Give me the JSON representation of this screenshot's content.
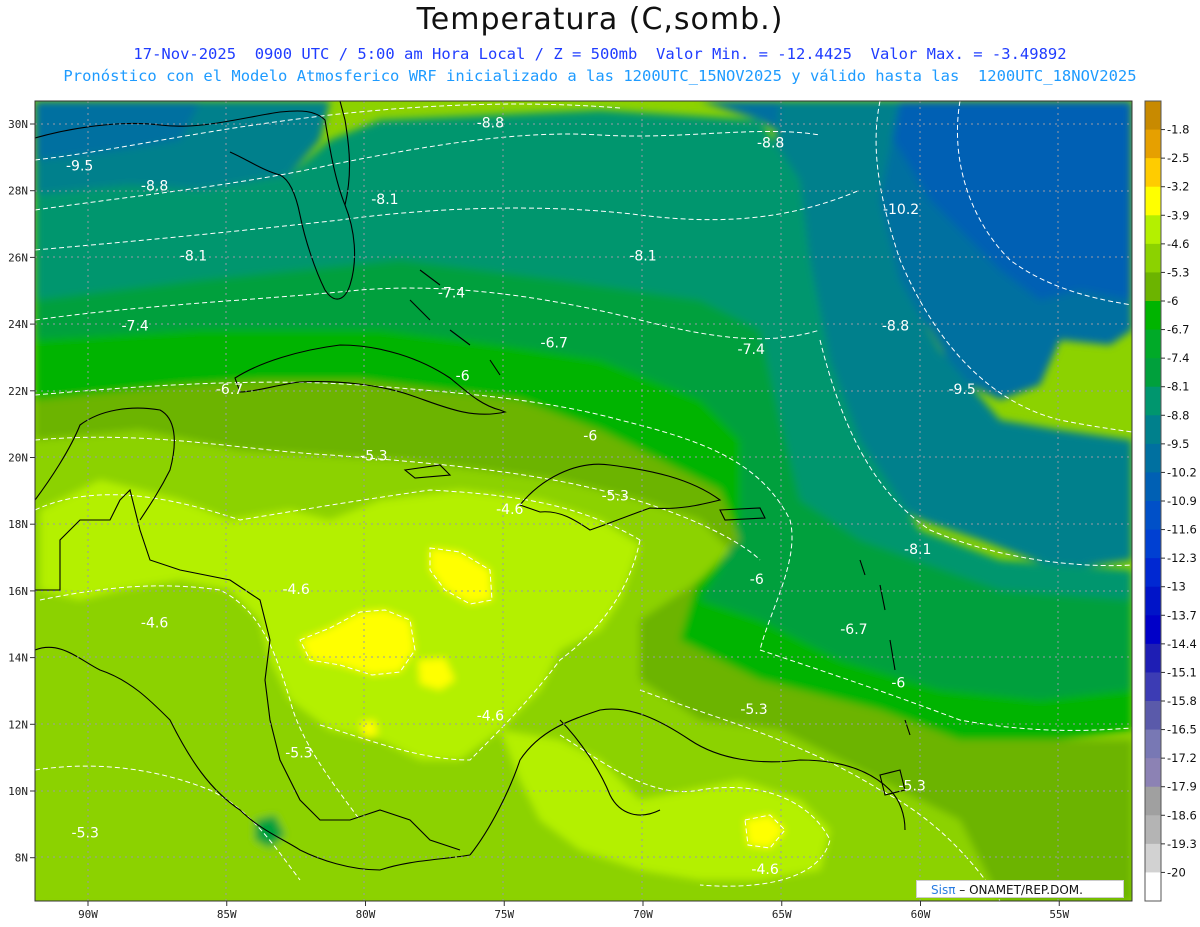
{
  "title": "Temperatura (C,somb.)",
  "subtitle_line1": "17-Nov-2025  0900 UTC / 5:00 am Hora Local / Z = 500mb  Valor Min. = -12.4425  Valor Max. = -3.49892",
  "subtitle_line2": "Pronóstico con el Modelo Atmosferico WRF inicializado a las 1200UTC_15NOV2025 y válido hasta las  1200UTC_18NOV2025",
  "map": {
    "lon_ticks": [
      "90W",
      "85W",
      "80W",
      "75W",
      "70W",
      "65W",
      "60W",
      "55W"
    ],
    "lat_ticks": [
      "30N",
      "28N",
      "26N",
      "24N",
      "22N",
      "20N",
      "18N",
      "16N",
      "14N",
      "12N",
      "10N",
      "8N"
    ],
    "contour_labels": [
      {
        "text": "-8.8",
        "lon": -75.5,
        "lat": 29.9
      },
      {
        "text": "-8.8",
        "lon": -65.4,
        "lat": 29.3
      },
      {
        "text": "-9.5",
        "lon": -90.3,
        "lat": 28.6
      },
      {
        "text": "-8.8",
        "lon": -87.6,
        "lat": 28.0
      },
      {
        "text": "-8.1",
        "lon": -79.3,
        "lat": 27.6
      },
      {
        "text": "-10.2",
        "lon": -60.7,
        "lat": 27.3
      },
      {
        "text": "-8.1",
        "lon": -86.2,
        "lat": 25.9
      },
      {
        "text": "-8.1",
        "lon": -70.0,
        "lat": 25.9
      },
      {
        "text": "-7.4",
        "lon": -76.9,
        "lat": 24.8
      },
      {
        "text": "-7.4",
        "lon": -88.3,
        "lat": 23.8
      },
      {
        "text": "-8.8",
        "lon": -60.9,
        "lat": 23.8
      },
      {
        "text": "-6.7",
        "lon": -73.2,
        "lat": 23.3
      },
      {
        "text": "-7.4",
        "lon": -66.1,
        "lat": 23.1
      },
      {
        "text": "-6",
        "lon": -76.5,
        "lat": 22.3
      },
      {
        "text": "-6.7",
        "lon": -84.9,
        "lat": 21.9
      },
      {
        "text": "-9.5",
        "lon": -58.5,
        "lat": 21.9
      },
      {
        "text": "-6",
        "lon": -71.9,
        "lat": 20.5
      },
      {
        "text": "-5.3",
        "lon": -79.7,
        "lat": 19.9
      },
      {
        "text": "-5.3",
        "lon": -71.0,
        "lat": 18.7
      },
      {
        "text": "-4.6",
        "lon": -74.8,
        "lat": 18.3
      },
      {
        "text": "-8.1",
        "lon": -60.1,
        "lat": 17.1
      },
      {
        "text": "-6",
        "lon": -65.9,
        "lat": 16.2
      },
      {
        "text": "-4.6",
        "lon": -82.5,
        "lat": 15.9
      },
      {
        "text": "-4.6",
        "lon": -87.6,
        "lat": 14.9
      },
      {
        "text": "-6.7",
        "lon": -62.4,
        "lat": 14.7
      },
      {
        "text": "-6",
        "lon": -60.8,
        "lat": 13.1
      },
      {
        "text": "-5.3",
        "lon": -66.0,
        "lat": 12.3
      },
      {
        "text": "-4.6",
        "lon": -75.5,
        "lat": 12.1
      },
      {
        "text": "-5.3",
        "lon": -82.4,
        "lat": 11.0
      },
      {
        "text": "-5.3",
        "lon": -60.3,
        "lat": 10.0
      },
      {
        "text": "-5.3",
        "lon": -90.1,
        "lat": 8.6
      },
      {
        "text": "-4.6",
        "lon": -65.6,
        "lat": 7.5
      }
    ]
  },
  "colorbar": {
    "levels": [
      "-1.8",
      "-2.5",
      "-3.2",
      "-3.9",
      "-4.6",
      "-5.3",
      "-6",
      "-6.7",
      "-7.4",
      "-8.1",
      "-8.8",
      "-9.5",
      "-10.2",
      "-10.9",
      "-11.6",
      "-12.3",
      "-13",
      "-13.7",
      "-14.4",
      "-15.1",
      "-15.8",
      "-16.5",
      "-17.2",
      "-17.9",
      "-18.6",
      "-19.3",
      "-20"
    ],
    "colors": [
      "#c88a00",
      "#e6a000",
      "#ffcc00",
      "#ffff00",
      "#b4f000",
      "#8cd200",
      "#6cb400",
      "#00b400",
      "#00aa28",
      "#00a03c",
      "#00966e",
      "#00808c",
      "#0070a0",
      "#0060b4",
      "#0050c8",
      "#0040d2",
      "#0028d2",
      "#0014c8",
      "#0000c8",
      "#1e1eb4",
      "#3c3cb4",
      "#5a5aaa",
      "#7878b4",
      "#8c82b4",
      "#a0a0a0",
      "#b4b4b4",
      "#d2d2d2",
      "#ffffff"
    ]
  },
  "credit": {
    "logo": "Sisπ",
    "text": " – ONAMET/REP.DOM."
  }
}
